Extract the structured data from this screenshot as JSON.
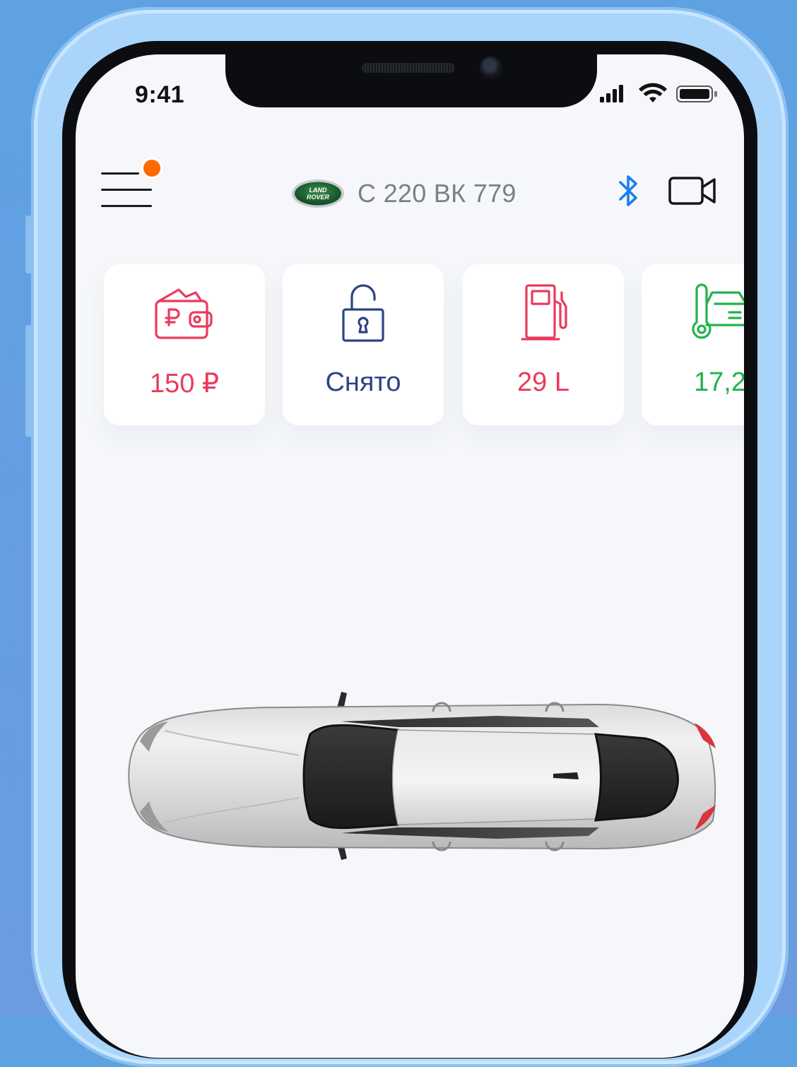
{
  "status_bar": {
    "time": "9:41"
  },
  "header": {
    "menu_label": "menu",
    "brand_logo_text": "LAND ROVER",
    "plate": "С 220 ВК 779"
  },
  "cards": [
    {
      "name": "balance",
      "value": "150 ₽",
      "color": "#ea3a5e",
      "icon": "wallet-ruble-icon"
    },
    {
      "name": "security",
      "value": "Снято",
      "color": "#2c4487",
      "icon": "unlocked-padlock-icon"
    },
    {
      "name": "fuel",
      "value": "29 L",
      "color": "#ea3a5e",
      "icon": "fuel-pump-icon"
    },
    {
      "name": "temperature",
      "value": "17,2",
      "color": "#23b24b",
      "icon": "car-thermometer-icon"
    }
  ],
  "colors": {
    "bluetooth": "#1a7ff0",
    "notification": "#ff6a00",
    "background": "#6ba0e4"
  }
}
